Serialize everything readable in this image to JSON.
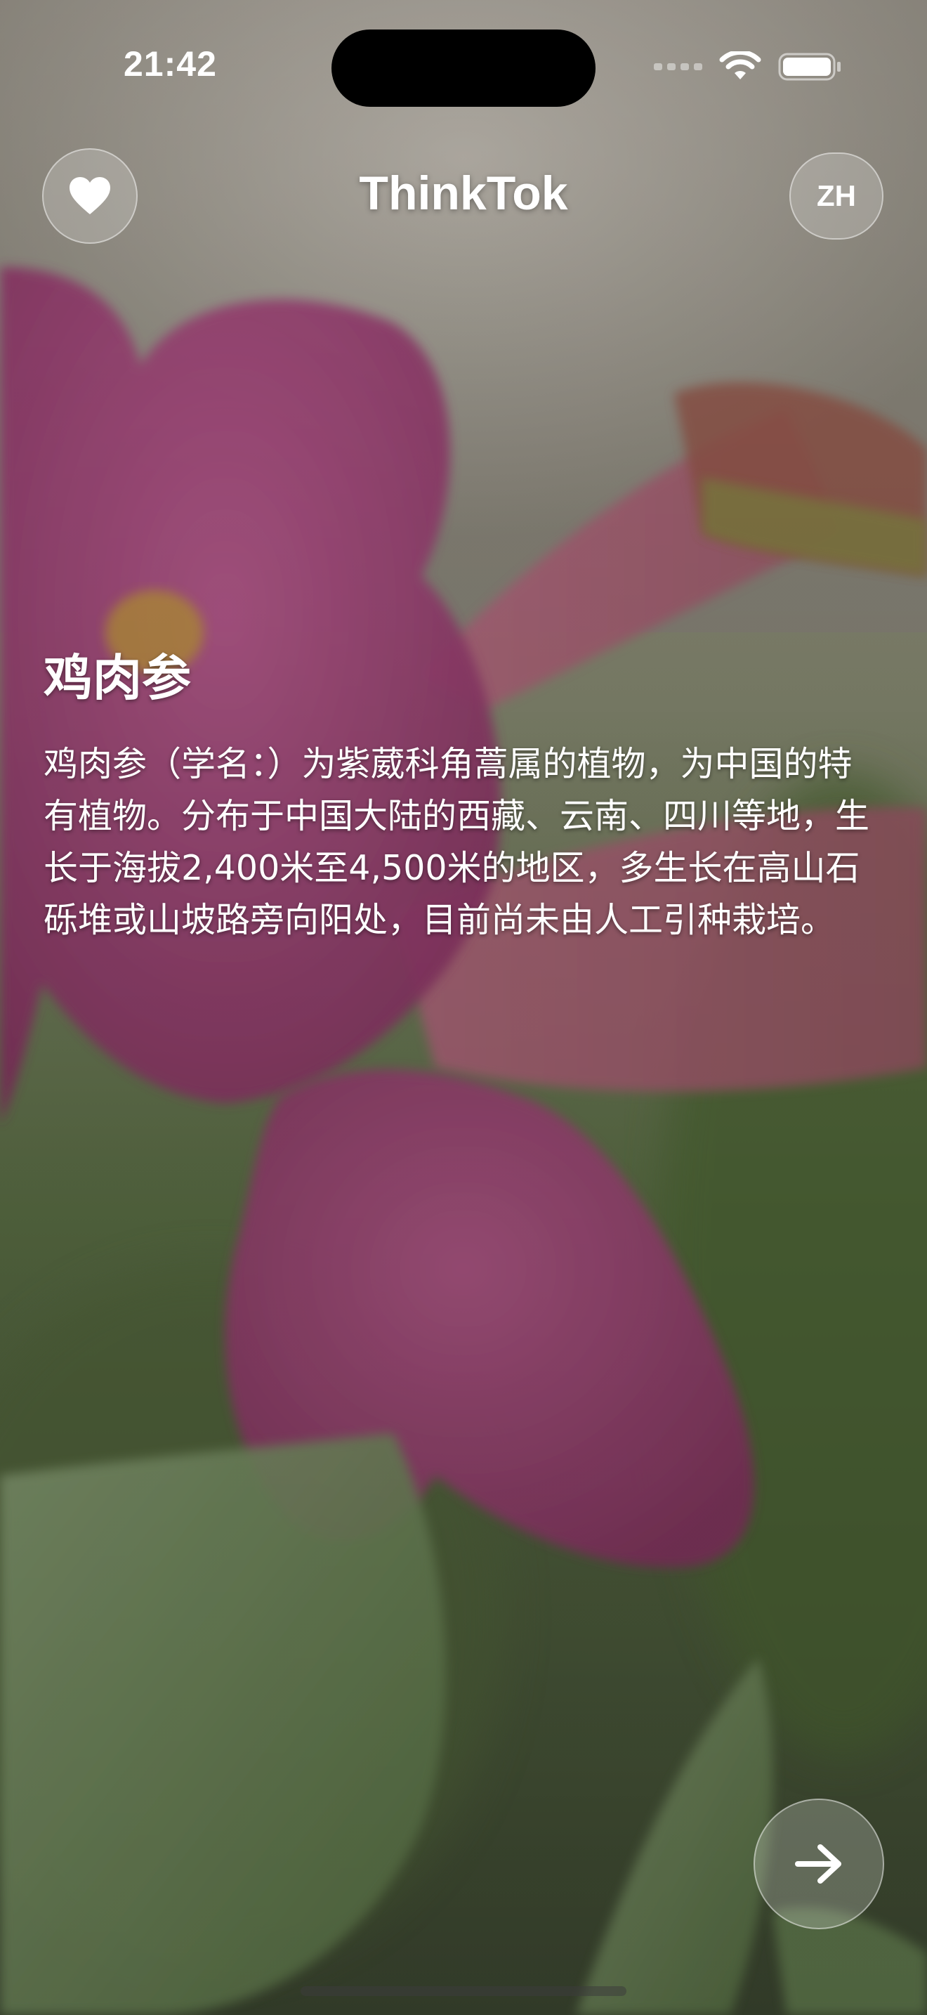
{
  "status_bar": {
    "time": "21:42",
    "icons": [
      "cellular-signal-icon",
      "wifi-icon",
      "battery-icon"
    ]
  },
  "header": {
    "title": "ThinkTok",
    "favorite_icon": "heart-icon",
    "language_label": "ZH"
  },
  "article": {
    "title": "鸡肉参",
    "body": "鸡肉参（学名：）为紫葳科角蒿属的植物，为中国的特有植物。分布于中国大陆的西藏、云南、四川等地，生长于海拔2,400米至4,500米的地区，多生长在高山石砾堆或山坡路旁向阳处，目前尚未由人工引种栽培。"
  },
  "controls": {
    "next_icon": "arrow-right-icon"
  },
  "colors": {
    "text": "#ffffff",
    "button_fill": "rgba(255,255,255,0.20)",
    "flower_pink": "#a8437e",
    "leaf_green": "#6f8a58"
  }
}
